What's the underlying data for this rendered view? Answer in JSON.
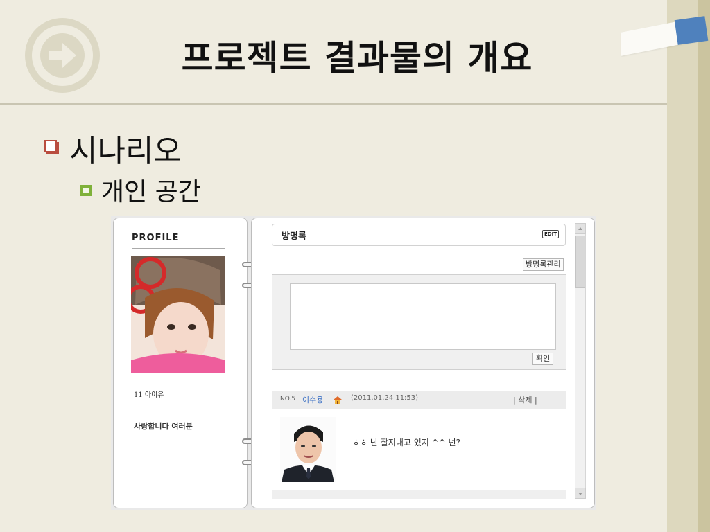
{
  "slide": {
    "title": "프로젝트 결과물의 개요",
    "bullet_level1": "시나리오",
    "bullet_level2": "개인 공간"
  },
  "colors": {
    "accent_red": "#b94d3f",
    "accent_green": "#7fb13a",
    "accent_blue": "#4f81bd",
    "link_blue": "#3a6fc4"
  },
  "profile": {
    "heading": "PROFILE",
    "name": "11 아이유",
    "message": "사랑합니다 여러분"
  },
  "guestbook": {
    "title": "방명록",
    "edit_label": "EDIT",
    "manage_label": "방명록관리",
    "confirm_label": "확인",
    "entry": {
      "number": "NO.5",
      "author": "이수용",
      "date": "(2011.01.24 11:53)",
      "delete_label": "| 삭제 |",
      "text": "ㅎㅎ 난 잘지내고 있지 ^^ 넌?"
    }
  }
}
